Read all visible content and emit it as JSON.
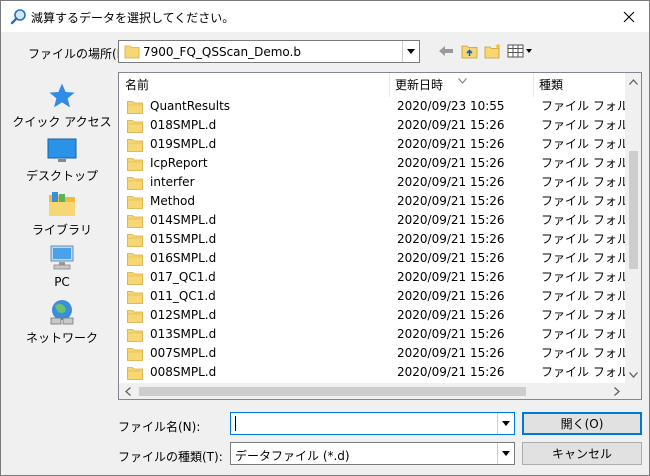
{
  "window": {
    "title": "減算するデータを選択してください。"
  },
  "lookin": {
    "label": "ファイルの場所(I):",
    "value": "7900_FQ_QSScan_Demo.b"
  },
  "places": [
    {
      "label": "クイック アクセス"
    },
    {
      "label": "デスクトップ"
    },
    {
      "label": "ライブラリ"
    },
    {
      "label": "PC"
    },
    {
      "label": "ネットワーク"
    }
  ],
  "columns": {
    "name": "名前",
    "date": "更新日時",
    "type": "種類"
  },
  "files": [
    {
      "name": "QuantResults",
      "date": "2020/09/23 10:55",
      "type": "ファイル フォルダー"
    },
    {
      "name": "018SMPL.d",
      "date": "2020/09/21 15:26",
      "type": "ファイル フォルダー"
    },
    {
      "name": "019SMPL.d",
      "date": "2020/09/21 15:26",
      "type": "ファイル フォルダー"
    },
    {
      "name": "IcpReport",
      "date": "2020/09/21 15:26",
      "type": "ファイル フォルダー"
    },
    {
      "name": "interfer",
      "date": "2020/09/21 15:26",
      "type": "ファイル フォルダー"
    },
    {
      "name": "Method",
      "date": "2020/09/21 15:26",
      "type": "ファイル フォルダー"
    },
    {
      "name": "014SMPL.d",
      "date": "2020/09/21 15:26",
      "type": "ファイル フォルダー"
    },
    {
      "name": "015SMPL.d",
      "date": "2020/09/21 15:26",
      "type": "ファイル フォルダー"
    },
    {
      "name": "016SMPL.d",
      "date": "2020/09/21 15:26",
      "type": "ファイル フォルダー"
    },
    {
      "name": "017_QC1.d",
      "date": "2020/09/21 15:26",
      "type": "ファイル フォルダー"
    },
    {
      "name": "011_QC1.d",
      "date": "2020/09/21 15:26",
      "type": "ファイル フォルダー"
    },
    {
      "name": "012SMPL.d",
      "date": "2020/09/21 15:26",
      "type": "ファイル フォルダー"
    },
    {
      "name": "013SMPL.d",
      "date": "2020/09/21 15:26",
      "type": "ファイル フォルダー"
    },
    {
      "name": "007SMPL.d",
      "date": "2020/09/21 15:26",
      "type": "ファイル フォルダー"
    },
    {
      "name": "008SMPL.d",
      "date": "2020/09/21 15:26",
      "type": "ファイル フォルダー"
    }
  ],
  "filename": {
    "label": "ファイル名(N):",
    "value": "",
    "placeholder": ""
  },
  "filetype": {
    "label": "ファイルの種類(T):",
    "value": "データファイル (*.d)"
  },
  "buttons": {
    "open": "開く(O)",
    "cancel": "キャンセル"
  },
  "colors": {
    "accent": "#0078d7",
    "folder": "#f7d774",
    "window_bg": "#f0f0f0"
  }
}
